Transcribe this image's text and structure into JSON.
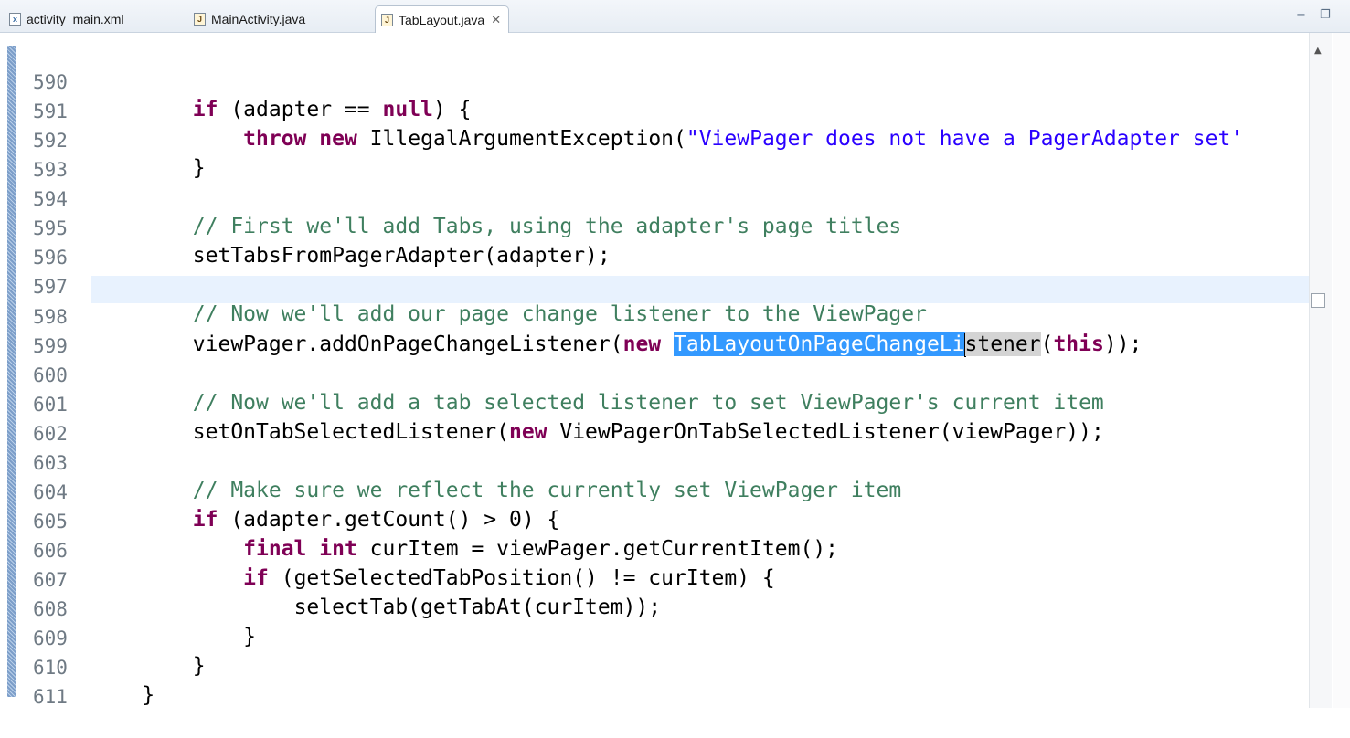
{
  "tabs": [
    {
      "label": "activity_main.xml",
      "icon": "xml-file-icon",
      "active": false
    },
    {
      "label": "MainActivity.java",
      "icon": "java-file-icon",
      "active": false
    },
    {
      "label": "TabLayout.java",
      "icon": "java-file-icon",
      "active": true,
      "close": "✕"
    }
  ],
  "window_controls": {
    "minimize": "−",
    "maximize": "❐"
  },
  "editor": {
    "current_line": 598,
    "selection_text": "TabLayoutOnPageChangeLi",
    "lines": [
      {
        "number": "590"
      },
      {
        "number": "591"
      },
      {
        "number": "592"
      },
      {
        "number": "593"
      },
      {
        "number": "594"
      },
      {
        "number": "595"
      },
      {
        "number": "596"
      },
      {
        "number": "597"
      },
      {
        "number": "598"
      },
      {
        "number": "599"
      },
      {
        "number": "600"
      },
      {
        "number": "601"
      },
      {
        "number": "602"
      },
      {
        "number": "603"
      },
      {
        "number": "604"
      },
      {
        "number": "605"
      },
      {
        "number": "606"
      },
      {
        "number": "607"
      },
      {
        "number": "608"
      },
      {
        "number": "609"
      },
      {
        "number": "610"
      },
      {
        "number": "611"
      }
    ],
    "code": {
      "l590": {
        "kw_if": "if",
        "a": " (adapter == ",
        "kw_null": "null",
        "b": ") {"
      },
      "l591": {
        "kw_throw": "throw",
        "kw_new": "new",
        "a": " IllegalArgumentException(",
        "str": "\"ViewPager does not have a PagerAdapter set'"
      },
      "l592": {
        "a": "}"
      },
      "l594": {
        "cmt": "// First we'll add Tabs, using the adapter's page titles"
      },
      "l595": {
        "a": "setTabsFromPagerAdapter(adapter);"
      },
      "l597": {
        "cmt": "// Now we'll add our page change listener to the ViewPager"
      },
      "l598": {
        "a": "viewPager.addOnPageChangeListener(",
        "kw_new": "new",
        "sel": "TabLayoutOnPageChangeLi",
        "occ": "stener",
        "b": "(",
        "kw_this": "this",
        "c": "));"
      },
      "l600": {
        "cmt": "// Now we'll add a tab selected listener to set ViewPager's current item"
      },
      "l601": {
        "a": "setOnTabSelectedListener(",
        "kw_new": "new",
        "b": " ViewPagerOnTabSelectedListener(viewPager));"
      },
      "l603": {
        "cmt": "// Make sure we reflect the currently set ViewPager item"
      },
      "l604": {
        "kw_if": "if",
        "a": " (adapter.getCount() > 0) {"
      },
      "l605": {
        "kw_final": "final",
        "kw_int": "int",
        "a": " curItem = viewPager.getCurrentItem();"
      },
      "l606": {
        "kw_if": "if",
        "a": " (getSelectedTabPosition() != curItem) {"
      },
      "l607": {
        "a": "selectTab(getTabAt(curItem));"
      },
      "l608": {
        "a": "}"
      },
      "l609": {
        "a": "}"
      },
      "l610": {
        "a": "}"
      }
    }
  },
  "colors": {
    "keyword": "#7f0055",
    "string": "#2a00ff",
    "comment": "#3f7f5f",
    "selection": "#3399ff",
    "current_line": "#e8f2fe"
  }
}
